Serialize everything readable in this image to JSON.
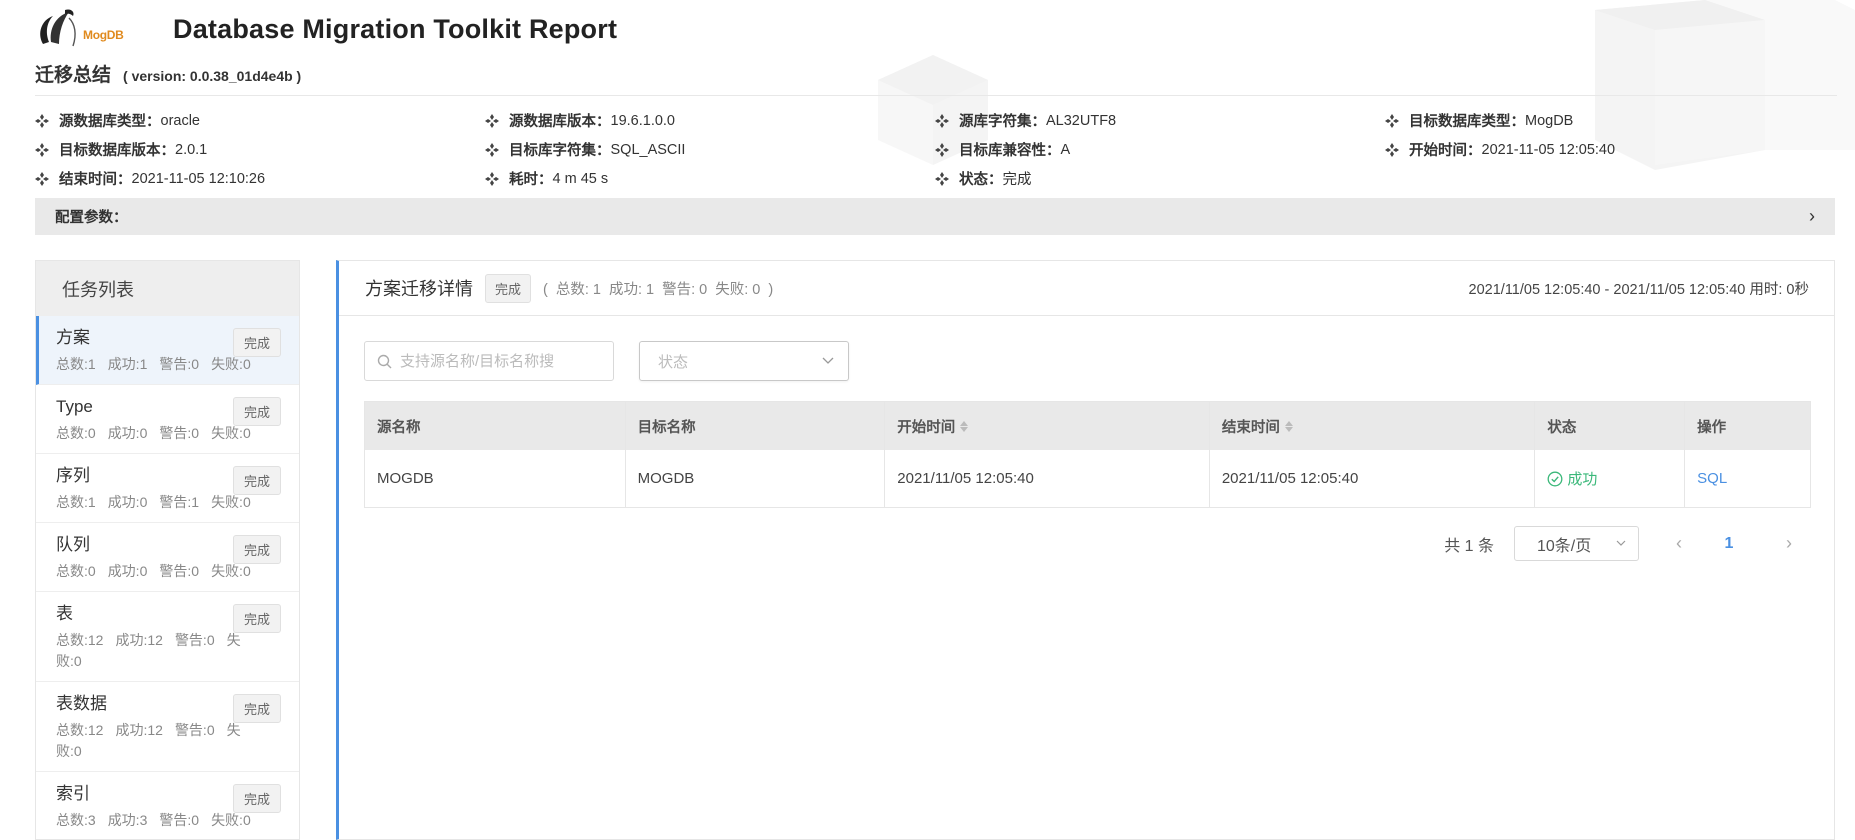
{
  "header": {
    "logo_text": "MogDB",
    "title": "Database Migration Toolkit Report"
  },
  "summary": {
    "title": "迁移总结",
    "version": "( version: 0.0.38_01d4e4b )"
  },
  "info": [
    {
      "label": "源数据库类型：",
      "value": "oracle"
    },
    {
      "label": "源数据库版本：",
      "value": "19.6.1.0.0"
    },
    {
      "label": "源库字符集：",
      "value": "AL32UTF8"
    },
    {
      "label": "目标数据库类型：",
      "value": "MogDB"
    },
    {
      "label": "目标数据库版本：",
      "value": "2.0.1"
    },
    {
      "label": "目标库字符集：",
      "value": "SQL_ASCII"
    },
    {
      "label": "目标库兼容性：",
      "value": "A"
    },
    {
      "label": "开始时间：",
      "value": "2021-11-05 12:05:40"
    },
    {
      "label": "结束时间：",
      "value": "2021-11-05 12:10:26"
    },
    {
      "label": "耗时：",
      "value": "4 m 45 s"
    },
    {
      "label": "状态：",
      "value": "完成"
    }
  ],
  "config": {
    "label": "配置参数：",
    "chevron": "›"
  },
  "task_list": {
    "title": "任务列表",
    "items": [
      {
        "name": "方案",
        "badge": "完成",
        "stats": [
          "总数:1",
          "成功:1",
          "警告:0",
          "失败:0"
        ]
      },
      {
        "name": "Type",
        "badge": "完成",
        "stats": [
          "总数:0",
          "成功:0",
          "警告:0",
          "失败:0"
        ]
      },
      {
        "name": "序列",
        "badge": "完成",
        "stats": [
          "总数:1",
          "成功:0",
          "警告:1",
          "失败:0"
        ]
      },
      {
        "name": "队列",
        "badge": "完成",
        "stats": [
          "总数:0",
          "成功:0",
          "警告:0",
          "失败:0"
        ]
      },
      {
        "name": "表",
        "badge": "完成",
        "stats": [
          "总数:12",
          "成功:12",
          "警告:0",
          "失败:0"
        ]
      },
      {
        "name": "表数据",
        "badge": "完成",
        "stats": [
          "总数:12",
          "成功:12",
          "警告:0",
          "失败:0"
        ]
      },
      {
        "name": "索引",
        "badge": "完成",
        "stats": [
          "总数:3",
          "成功:3",
          "警告:0",
          "失败:0"
        ]
      }
    ]
  },
  "detail": {
    "title": "方案迁移详情",
    "badge": "完成",
    "stats_open": "(",
    "stats": [
      "总数: 1",
      "成功: 1",
      "警告: 0",
      "失败: 0"
    ],
    "stats_close": ")",
    "time_range": "2021/11/05 12:05:40 - 2021/11/05 12:05:40 用时: 0秒",
    "search_placeholder": "支持源名称/目标名称搜",
    "status_placeholder": "状态",
    "columns": [
      "源名称",
      "目标名称",
      "开始时间",
      "结束时间",
      "状态",
      "操作"
    ],
    "rows": [
      {
        "source": "MOGDB",
        "target": "MOGDB",
        "start": "2021/11/05 12:05:40",
        "end": "2021/11/05 12:05:40",
        "status": "成功",
        "action": "SQL"
      }
    ],
    "pager": {
      "total": "共 1 条",
      "page_size": "10条/页",
      "current": "1",
      "prev": "‹",
      "next": "›"
    }
  },
  "colors": {
    "accent": "#4a90e2",
    "success": "#3bb87a",
    "logo": "#e08a1e"
  }
}
